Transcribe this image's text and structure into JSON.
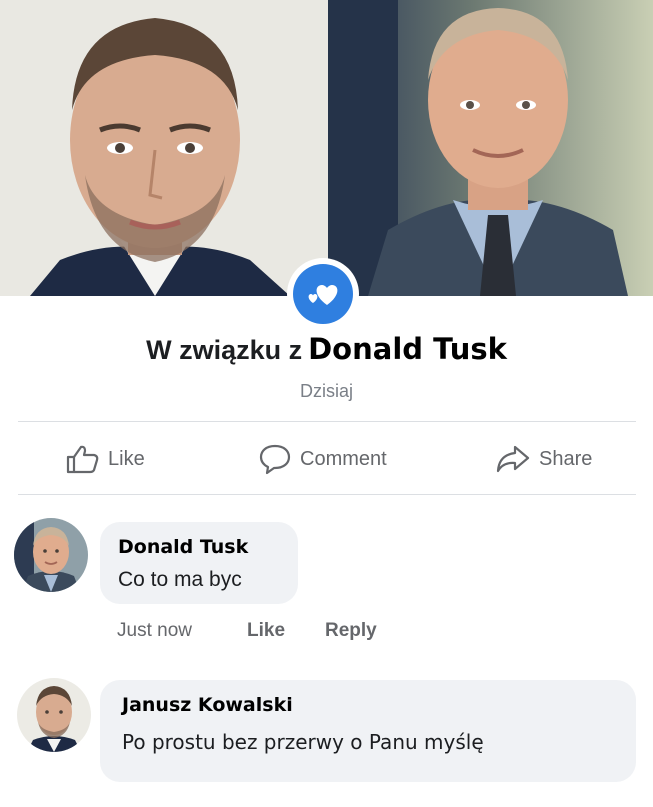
{
  "colors": {
    "accent": "#2f7fe0",
    "bubble": "#f0f2f5",
    "muted": "#65676b"
  },
  "photos": {
    "left_alt": "Janusz Kowalski",
    "right_alt": "Donald Tusk",
    "badge_icon": "hearts-icon"
  },
  "post": {
    "headline_prefix": "W związku z",
    "headline_name": "Donald Tusk",
    "date": "Dzisiaj"
  },
  "actions": [
    {
      "label": "Like",
      "icon": "thumbs-up-icon"
    },
    {
      "label": "Comment",
      "icon": "comment-icon"
    },
    {
      "label": "Share",
      "icon": "share-icon"
    }
  ],
  "comments": [
    {
      "author": "Donald Tusk",
      "text": "Co to ma byc",
      "time": "Just now",
      "like": "Like",
      "reply": "Reply"
    },
    {
      "author": "Janusz Kowalski",
      "text": "Po prostu bez przerwy o Panu myślę"
    }
  ]
}
